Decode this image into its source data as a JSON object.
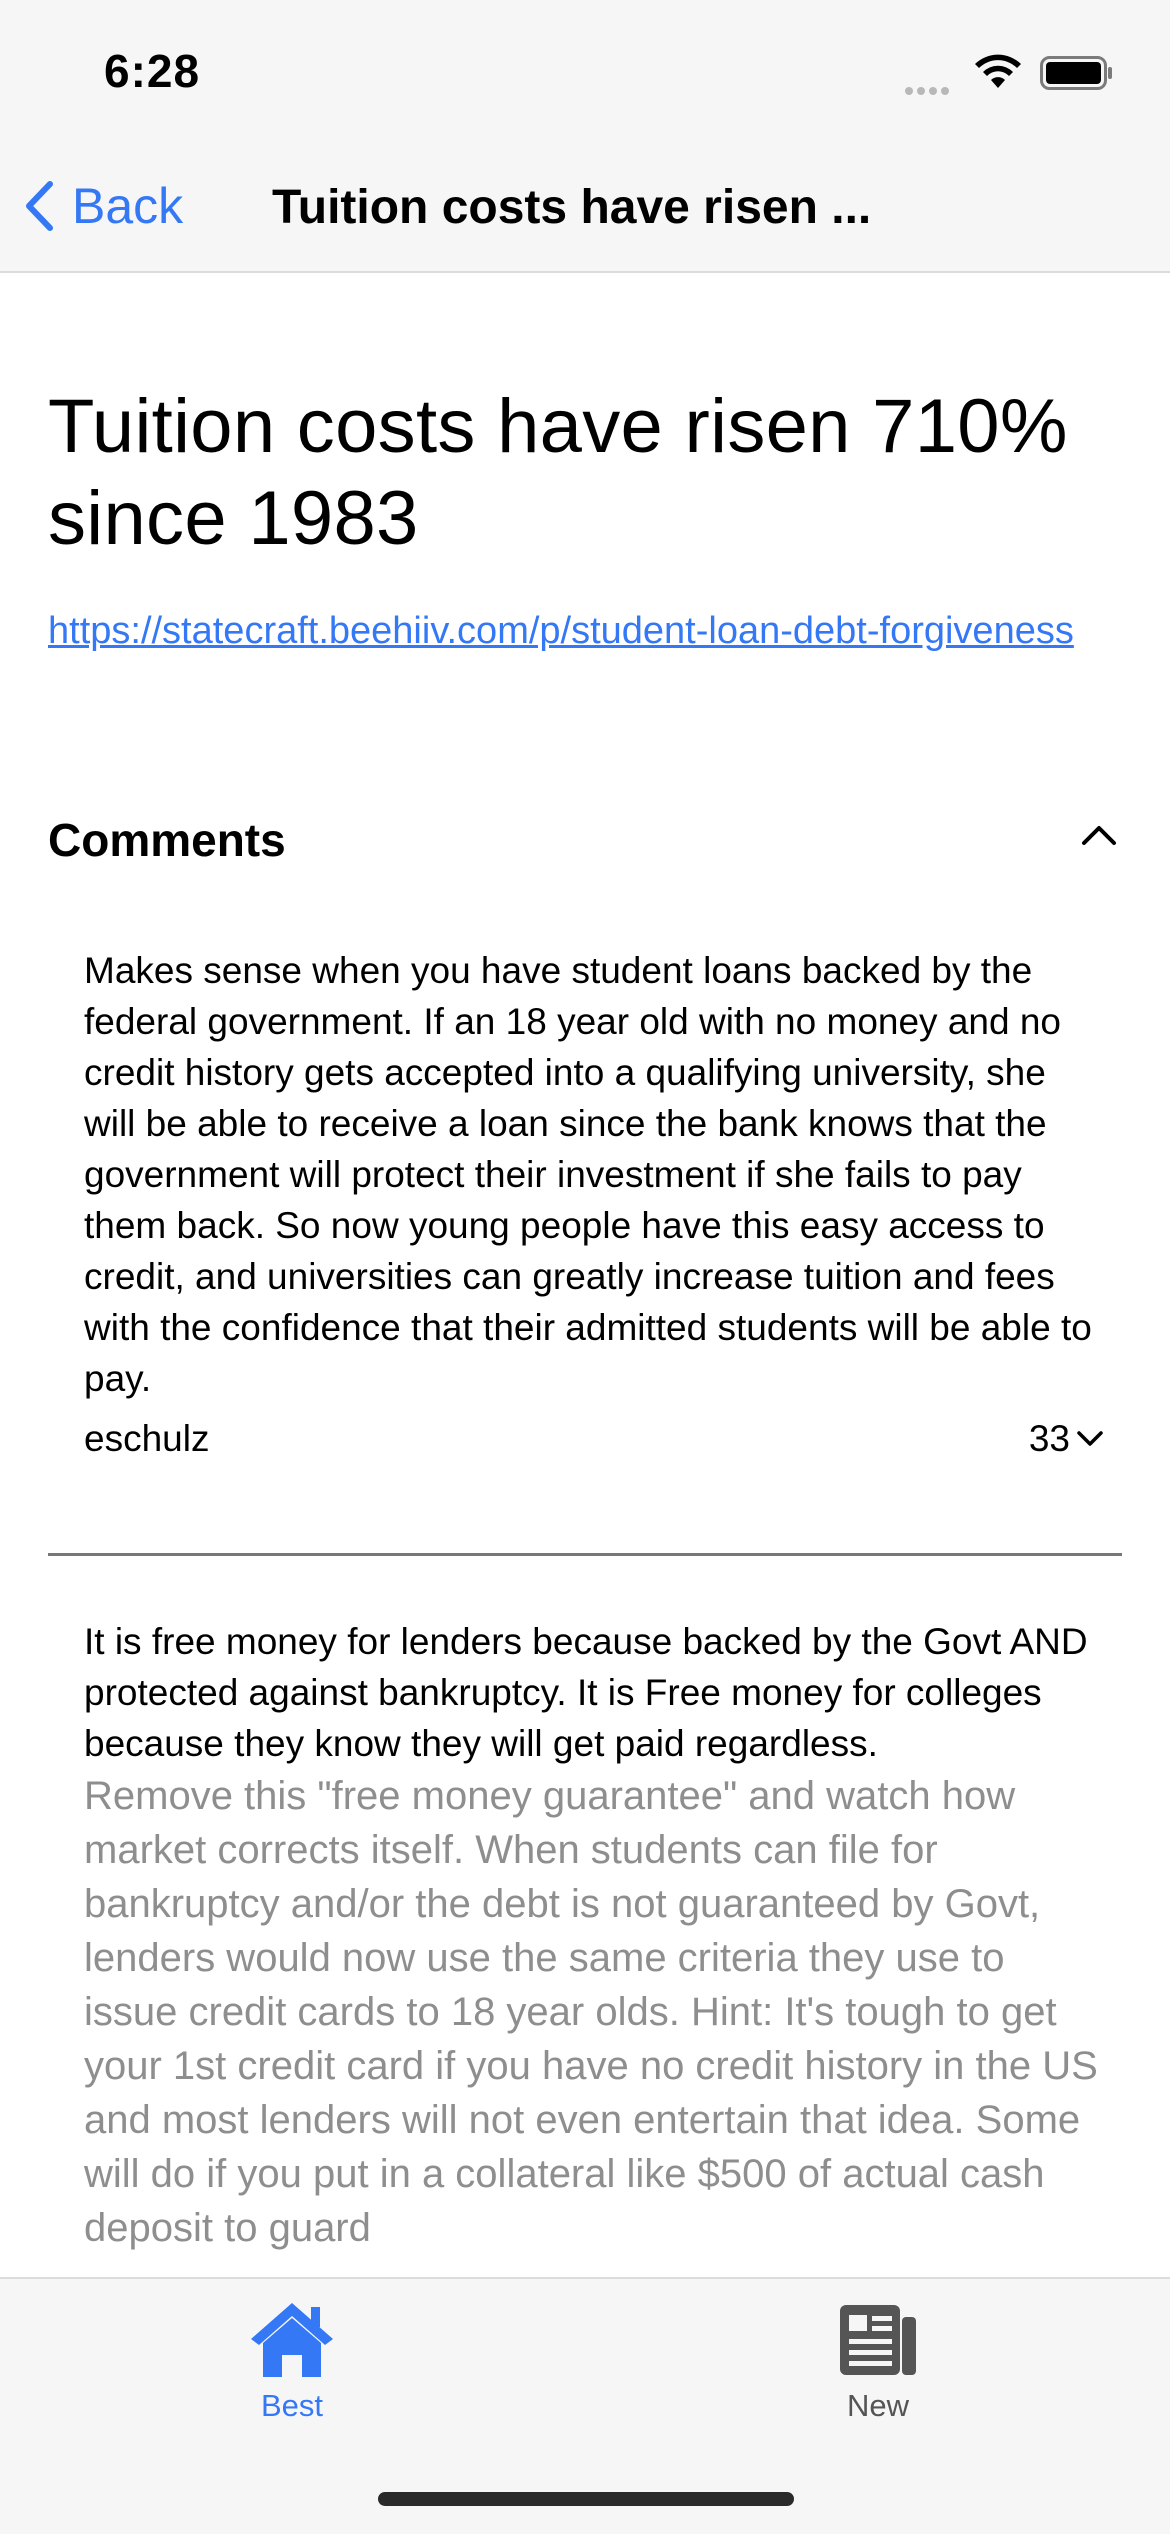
{
  "status_bar": {
    "time": "6:28"
  },
  "nav": {
    "back_label": "Back",
    "title": "Tuition costs have risen ..."
  },
  "story": {
    "title": "Tuition costs have risen 710% since 1983",
    "url": "https://statecraft.beehiiv.com/p/student-loan-debt-forgiveness"
  },
  "comments": {
    "header": "Comments",
    "items": [
      {
        "text": "Makes sense when you have student loans backed by the federal government. If an 18 year old with no money and no credit history gets accepted into a qualifying university, she will be able to receive a loan since the bank knows that the government will protect their investment if she fails to pay them back. So now young people have this easy access to credit, and universities can greatly increase tuition and fees with the confidence that their admitted students will be able to pay.",
        "author": "eschulz",
        "votes": "33"
      },
      {
        "text": "It is free money for lenders because backed by the Govt AND protected against bankruptcy. It is Free money for colleges because they know they will get paid regardless.",
        "quoted_text": "Remove this \"free money guarantee\" and watch how market corrects itself. When students can file for bankruptcy and/or the debt is not guaranteed by Govt, lenders would now use the same criteria they use to issue credit cards to 18 year olds. Hint: It's tough to get your 1st credit card if you have no credit history in the US and most lenders will not even entertain that idea. Some will do if you put in a collateral like $500 of actual cash deposit to guard"
      }
    ]
  },
  "tabs": [
    {
      "label": "Best",
      "icon": "house-icon",
      "selected": true
    },
    {
      "label": "New",
      "icon": "newspaper-icon",
      "selected": false
    }
  ],
  "colors": {
    "accent": "#3478f6",
    "bar_bg": "#f6f6f6",
    "muted_text": "#8e8e8e"
  }
}
